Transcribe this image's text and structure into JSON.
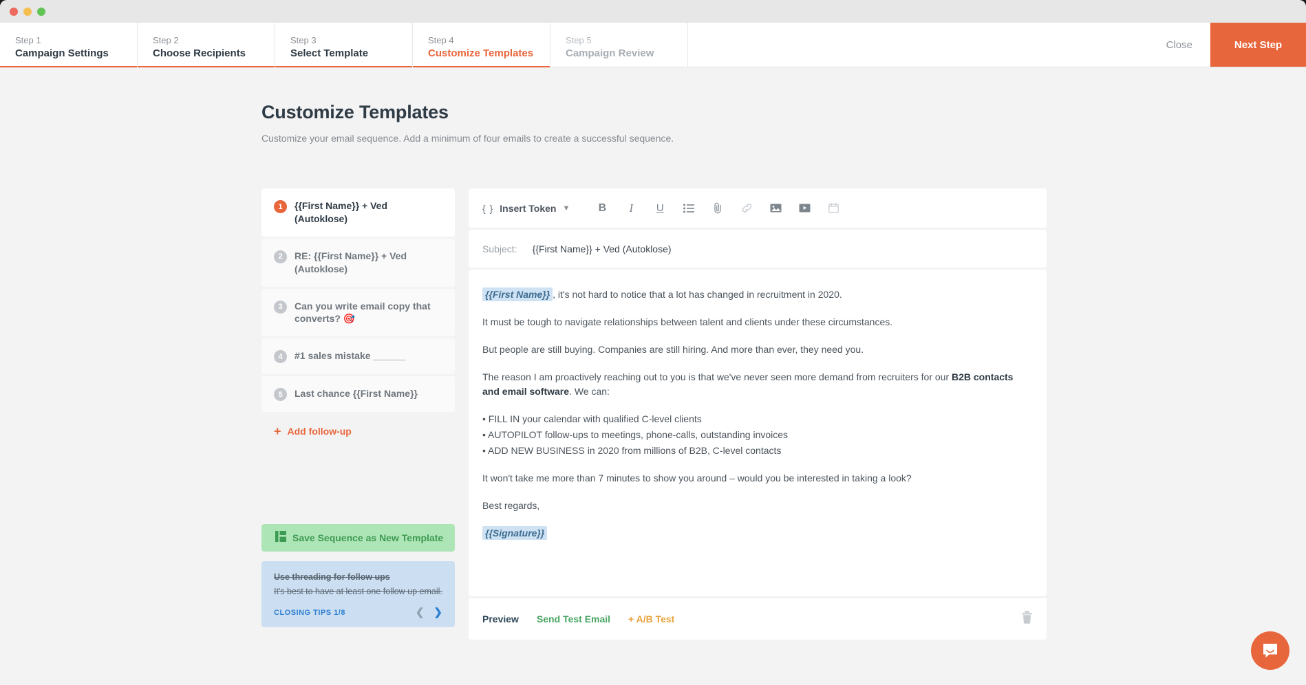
{
  "window": {
    "title_dots": [
      "close",
      "minimize",
      "zoom"
    ]
  },
  "steps": [
    {
      "num": "Step 1",
      "name": "Campaign Settings",
      "state": "done"
    },
    {
      "num": "Step 2",
      "name": "Choose Recipients",
      "state": "done"
    },
    {
      "num": "Step 3",
      "name": "Select Template",
      "state": "done"
    },
    {
      "num": "Step 4",
      "name": "Customize Templates",
      "state": "active"
    },
    {
      "num": "Step 5",
      "name": "Campaign Review",
      "state": "future"
    }
  ],
  "header": {
    "close_label": "Close",
    "next_label": "Next Step"
  },
  "page": {
    "title": "Customize Templates",
    "subtitle": "Customize your email sequence. Add a minimum of four emails to create a successful sequence."
  },
  "sidebar": {
    "items": [
      {
        "badge": "1",
        "label": "{{First Name}} + Ved (Autoklose)",
        "active": true
      },
      {
        "badge": "2",
        "label": "RE: {{First Name}} + Ved (Autoklose)",
        "active": false
      },
      {
        "badge": "3",
        "label": "Can you write email copy that converts? 🎯",
        "active": false
      },
      {
        "badge": "4",
        "label": "#1 sales mistake ______",
        "active": false
      },
      {
        "badge": "5",
        "label": "Last chance {{First Name}}",
        "active": false
      }
    ],
    "add_follow_up": "Add follow-up",
    "save_template": "Save Sequence as New Template",
    "tips": {
      "title": "Use threading for follow ups",
      "body": "It's best to have at least one follow up email.",
      "counter": "CLOSING TIPS 1/8"
    }
  },
  "editor": {
    "toolbar": {
      "token_braces": "{ }",
      "token_label": "Insert Token",
      "chevron": "⌄",
      "bold": "B",
      "italic": "I",
      "underline": "U"
    },
    "subject_label": "Subject:",
    "subject_value": "{{First Name}} + Ved (Autoklose)",
    "body": {
      "greeting_token": "{{First Name}}",
      "greeting_rest": ", it's not hard to notice that a lot has changed in recruitment in 2020.",
      "p2": "It must be tough to navigate relationships between talent and clients under these circumstances.",
      "p3": "But people are still buying. Companies are still hiring. And more than ever, they need you.",
      "p4_pre": "The reason I am proactively reaching out to you is that we've never seen more demand from recruiters for our ",
      "p4_bold": "B2B contacts and email software",
      "p4_post": ". We can:",
      "bullets": [
        "• FILL IN your calendar with qualified C-level clients",
        "• AUTOPILOT follow-ups to meetings, phone-calls, outstanding invoices",
        "• ADD NEW BUSINESS in 2020 from millions of B2B, C-level contacts"
      ],
      "p5": "It won't take me more than 7 minutes to show you around – would you be interested in taking a look?",
      "signoff": "Best regards,",
      "signature_token": "{{Signature}}"
    },
    "footer": {
      "preview": "Preview",
      "send_test": "Send Test Email",
      "ab_test": "+ A/B Test"
    }
  },
  "colors": {
    "accent_orange": "#e8663c",
    "green": "#4aa564",
    "amber": "#e8a33d",
    "blue": "#2f7fd1"
  }
}
